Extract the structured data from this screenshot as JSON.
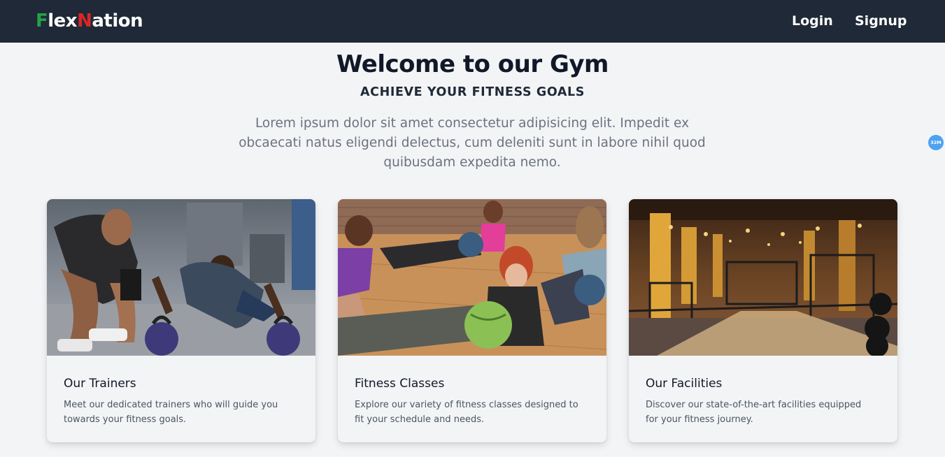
{
  "nav": {
    "brand_first_letter": "F",
    "brand_part1": "lex",
    "brand_second_letter": "N",
    "brand_part2": "ation",
    "login": "Login",
    "signup": "Signup"
  },
  "hero": {
    "title": "Welcome to our Gym",
    "subtitle": "ACHIEVE YOUR FITNESS GOALS",
    "text": "Lorem ipsum dolor sit amet consectetur adipisicing elit. Impedit ex obcaecati natus eligendi delectus, cum deleniti sunt in labore nihil quod quibusdam expedita nemo."
  },
  "cards": [
    {
      "title": "Our Trainers",
      "description": "Meet our dedicated trainers who will guide you towards your fitness goals.",
      "image": "trainer-coaching-pushups-photo"
    },
    {
      "title": "Fitness Classes",
      "description": "Explore our variety of fitness classes designed to fit your schedule and needs.",
      "image": "group-fitness-class-photo"
    },
    {
      "title": "Our Facilities",
      "description": "Discover our state-of-the-art facilities equipped for your fitness journey.",
      "image": "gym-interior-photo"
    }
  ],
  "badge": {
    "text": "32M"
  },
  "colors": {
    "navbar": "#1f2937",
    "brand_green": "#22a34a",
    "brand_red": "#dc2626",
    "page_bg": "#f3f4f6",
    "badge": "#4ea3f0"
  }
}
